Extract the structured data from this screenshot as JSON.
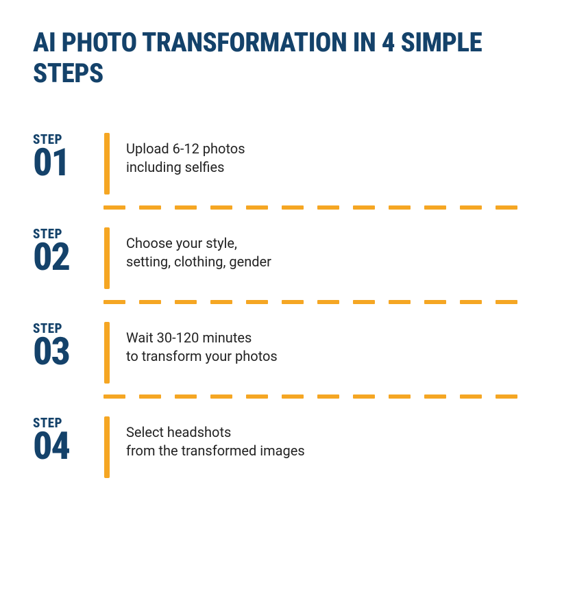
{
  "title": "AI PHOTO TRANSFORMATION\nIN 4 SIMPLE STEPS",
  "step_label": "STEP",
  "steps": [
    {
      "number": "01",
      "description": "Upload 6-12 photos\nincluding selfies"
    },
    {
      "number": "02",
      "description": "Choose your style,\nsetting, clothing, gender"
    },
    {
      "number": "03",
      "description": "Wait 30-120 minutes\nto transform your photos"
    },
    {
      "number": "04",
      "description": "Select headshots\nfrom the transformed images"
    }
  ]
}
